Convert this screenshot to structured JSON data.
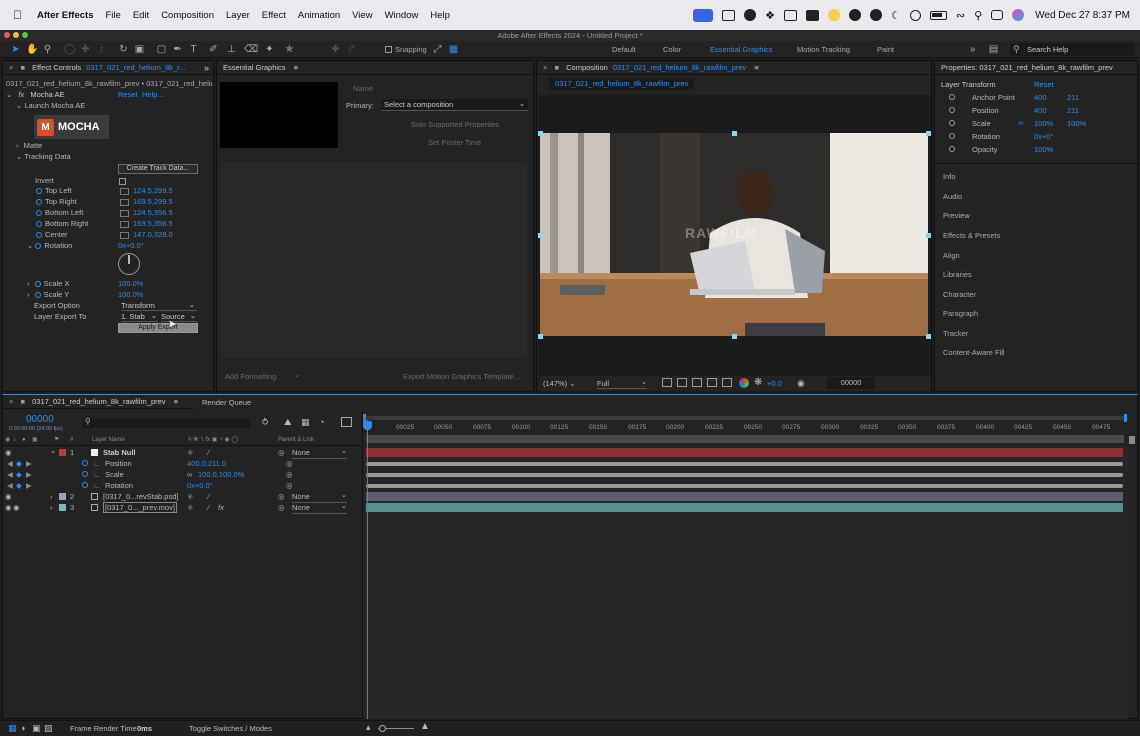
{
  "menubar": {
    "app": "After Effects",
    "items": [
      "File",
      "Edit",
      "Composition",
      "Layer",
      "Effect",
      "Animation",
      "View",
      "Window",
      "Help"
    ],
    "clock": "Wed Dec 27  8:37 PM"
  },
  "window": {
    "title": "Adobe After Effects 2024 - Untitled Project *"
  },
  "toolbar": {
    "snapping": "Snapping",
    "workspaces": [
      "Default",
      "Color",
      "Essential Graphics",
      "Motion Tracking",
      "Paint"
    ],
    "active_workspace": "Essential Graphics",
    "search_placeholder": "Search Help"
  },
  "effect_controls": {
    "tab_label": "Effect Controls",
    "tab_comp": "0317_021_red_helium_8k_r...",
    "header": "0317_021_red_helium_8k_rawfilm_prev • 0317_021_red_heliu",
    "effect_name": "Mocha AE",
    "reset": "Reset",
    "help": "Help...",
    "launch": "Launch Mocha AE",
    "logo_text": "MOCHA",
    "matte": "Matte",
    "tracking_data": "Tracking Data",
    "create_track": "Create Track Data...",
    "invert": "Invert",
    "params": [
      {
        "label": "Top Left",
        "value": "124.5,299.5"
      },
      {
        "label": "Top Right",
        "value": "169.5,299.5"
      },
      {
        "label": "Bottom Left",
        "value": "124.5,356.5"
      },
      {
        "label": "Bottom Right",
        "value": "169.5,356.5"
      },
      {
        "label": "Center",
        "value": "147.0,328.0"
      }
    ],
    "rotation_label": "Rotation",
    "rotation_value": "0x+0.0°",
    "scale_x_label": "Scale X",
    "scale_x_value": "100.0%",
    "scale_y_label": "Scale Y",
    "scale_y_value": "100.0%",
    "export_option_label": "Export Option",
    "export_option_value": "Transform",
    "layer_export_label": "Layer Export To",
    "layer_export_value": "1. Stab",
    "source_value": "Source",
    "apply_export": "Apply Export"
  },
  "essential_graphics": {
    "tab_label": "Essential Graphics",
    "name_label": "Name",
    "primary_label": "Primary:",
    "primary_value": "Select a composition",
    "solo": "Solo Supported Properties",
    "poster": "Set Poster Time",
    "add_formatting": "Add Formatting",
    "export_template": "Export Motion Graphics Template..."
  },
  "composition": {
    "tab_label": "Composition",
    "tab_comp": "0317_021_red_helium_8k_rawfilm_prev",
    "subtab": "0317_021_red_helium_8k_rawfilm_prev",
    "watermark": "RAWFILM",
    "zoom": "(147%)",
    "resolution": "Full",
    "exposure": "+0.0",
    "timecode": "00000"
  },
  "properties": {
    "tab_label": "Properties: 0317_021_red_helium_8k_rawfilm_prev",
    "section": "Layer Transform",
    "reset": "Reset",
    "rows": [
      {
        "label": "Anchor Point",
        "v1": "400",
        "v2": "211"
      },
      {
        "label": "Position",
        "v1": "400",
        "v2": "211"
      },
      {
        "label": "Scale",
        "v1": "100%",
        "v2": "100%"
      },
      {
        "label": "Rotation",
        "v1": "0x+0°",
        "v2": ""
      },
      {
        "label": "Opacity",
        "v1": "100%",
        "v2": ""
      }
    ],
    "panels": [
      "Info",
      "Audio",
      "Preview",
      "Effects & Presets",
      "Align",
      "Libraries",
      "Character",
      "Paragraph",
      "Tracker",
      "Content-Aware Fill"
    ]
  },
  "timeline": {
    "tab_label": "0317_021_red_helium_8k_rawfilm_prev",
    "render_queue": "Render Queue",
    "timecode": "00000",
    "timecode_sub": "0:00:00:00 (24.00 fps)",
    "col_layer_name": "Layer Name",
    "col_parent": "Parent & Link",
    "ticks": [
      "00025",
      "00050",
      "00075",
      "00100",
      "00125",
      "00150",
      "00175",
      "00200",
      "00225",
      "00250",
      "00275",
      "00300",
      "00325",
      "00350",
      "00375",
      "00400",
      "00425",
      "00450",
      "00475"
    ],
    "layers": [
      {
        "num": "1",
        "name": "Stab Null",
        "parent": "None",
        "color": "#c03a3a",
        "bar": "#8a2f35"
      },
      {
        "num": "2",
        "name": "[0317_0...revStab.psd]",
        "parent": "None",
        "color": "#9c9cc8",
        "bar": "#5c5c72"
      },
      {
        "num": "3",
        "name": "[0317_0..._prev.mov]",
        "parent": "None",
        "color": "#7ab8b8",
        "bar": "#5c9090"
      }
    ],
    "sub_props": [
      {
        "label": "Position",
        "value": "400.0,211.0"
      },
      {
        "label": "Scale",
        "value": "100.0,100.0%"
      },
      {
        "label": "Rotation",
        "value": "0x+0.0°"
      }
    ]
  },
  "status": {
    "render_label": "Frame Render Time",
    "render_value": "0ms",
    "toggle": "Toggle Switches / Modes"
  }
}
